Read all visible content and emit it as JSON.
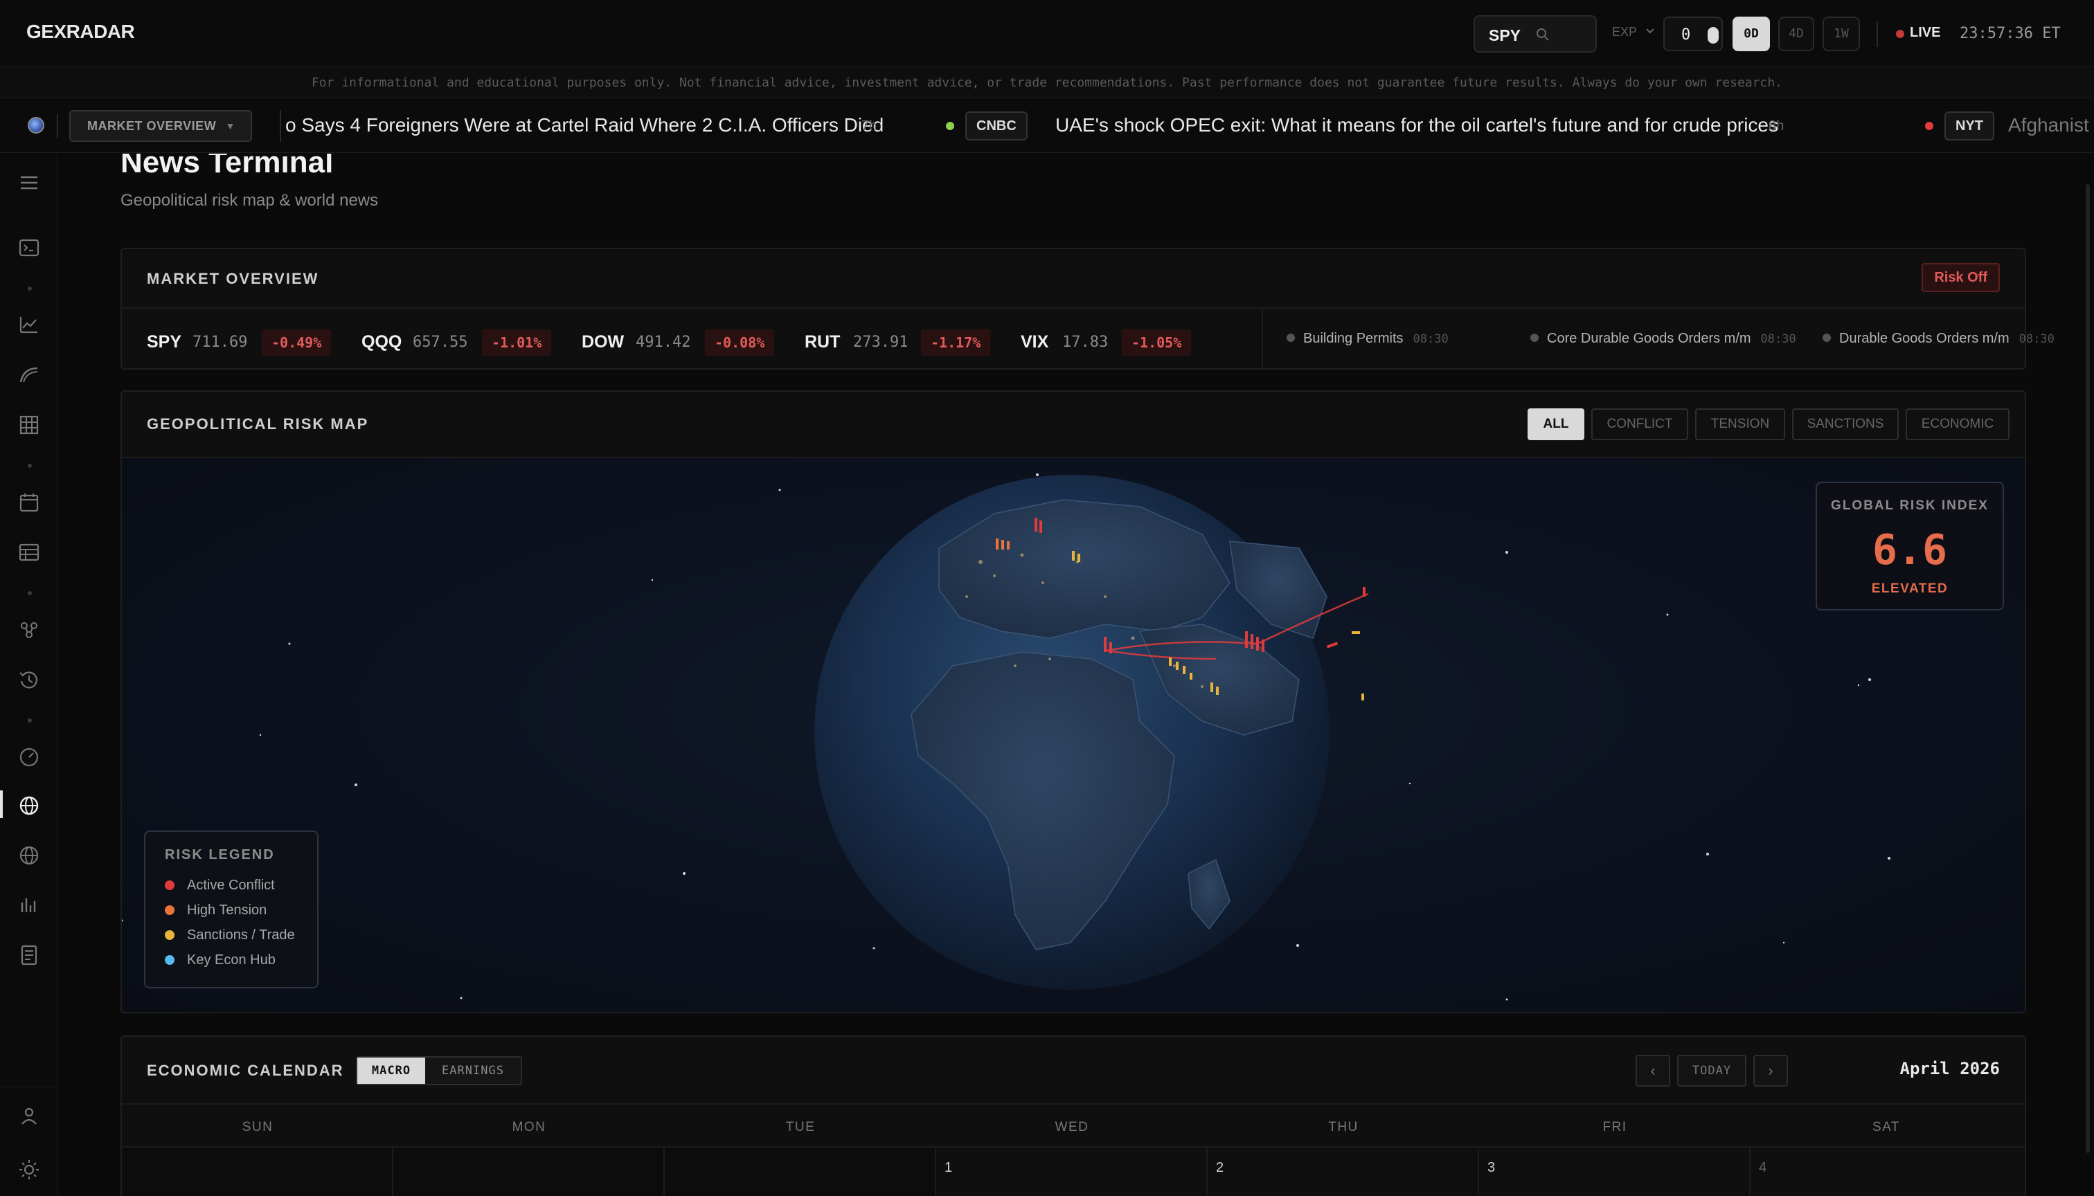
{
  "app": {
    "logo": "GEXRADAR"
  },
  "topbar": {
    "search_ticker": "SPY",
    "exp_label": "EXP",
    "exp_value": "0",
    "ranges": [
      "0D",
      "4D",
      "1W"
    ],
    "active_range": "0D",
    "live_label": "LIVE",
    "clock": "23:57:36 ET"
  },
  "disclaimer": "For informational and educational purposes only. Not financial advice, investment advice, or trade recommendations. Past performance does not guarantee future results. Always do your own research.",
  "tickerbar": {
    "dropdown_label": "MARKET OVERVIEW",
    "news": [
      {
        "source": "",
        "headline": "o Says 4 Foreigners Were at Cartel Raid Where 2 C.I.A. Officers Died",
        "age": "7h",
        "dot_color": ""
      },
      {
        "source": "CNBC",
        "headline": "UAE's shock OPEC exit: What it means for the oil cartel's future and for crude prices",
        "age": "8h",
        "dot_color": "#8fd14f"
      },
      {
        "source": "NYT",
        "headline": "Afghanist",
        "age": "",
        "dot_color": "#e23b3b"
      }
    ]
  },
  "page": {
    "title": "News Terminal",
    "subtitle": "Geopolitical risk map & world news"
  },
  "market_overview": {
    "title": "MARKET OVERVIEW",
    "regime_badge": "Risk Off",
    "quotes": [
      {
        "symbol": "SPY",
        "price": "711.69",
        "change": "-0.49%"
      },
      {
        "symbol": "QQQ",
        "price": "657.55",
        "change": "-1.01%"
      },
      {
        "symbol": "DOW",
        "price": "491.42",
        "change": "-0.08%"
      },
      {
        "symbol": "RUT",
        "price": "273.91",
        "change": "-1.17%"
      },
      {
        "symbol": "VIX",
        "price": "17.83",
        "change": "-1.05%"
      }
    ],
    "events": [
      {
        "name": "Building Permits",
        "time": "08:30"
      },
      {
        "name": "Core Durable Goods Orders m/m",
        "time": "08:30"
      },
      {
        "name": "Durable Goods Orders m/m",
        "time": "08:30"
      }
    ]
  },
  "geo_map": {
    "title": "GEOPOLITICAL RISK MAP",
    "filters": [
      "ALL",
      "CONFLICT",
      "TENSION",
      "SANCTIONS",
      "ECONOMIC"
    ],
    "active_filter": "ALL",
    "risk_index": {
      "label": "GLOBAL RISK INDEX",
      "value": "6.6",
      "level": "ELEVATED",
      "color": "#e66d4b"
    },
    "legend": {
      "title": "RISK LEGEND",
      "items": [
        {
          "label": "Active Conflict",
          "color": "#e23b3b"
        },
        {
          "label": "High Tension",
          "color": "#e8743b"
        },
        {
          "label": "Sanctions / Trade",
          "color": "#e8b43b"
        },
        {
          "label": "Key Econ Hub",
          "color": "#5ab8f0"
        }
      ]
    }
  },
  "calendar": {
    "title": "ECONOMIC CALENDAR",
    "tabs": [
      "MACRO",
      "EARNINGS"
    ],
    "active_tab": "MACRO",
    "today_label": "TODAY",
    "prev_icon": "‹",
    "next_icon": "›",
    "month": "April 2026",
    "weekdays": [
      "SUN",
      "MON",
      "TUE",
      "WED",
      "THU",
      "FRI",
      "SAT"
    ],
    "first_week": [
      "",
      "",
      "",
      "1",
      "2",
      "3",
      "4"
    ]
  },
  "colors": {
    "accent_negative": "#e25a5a",
    "background": "#0a0a0a",
    "panel": "#0f0f0f"
  }
}
